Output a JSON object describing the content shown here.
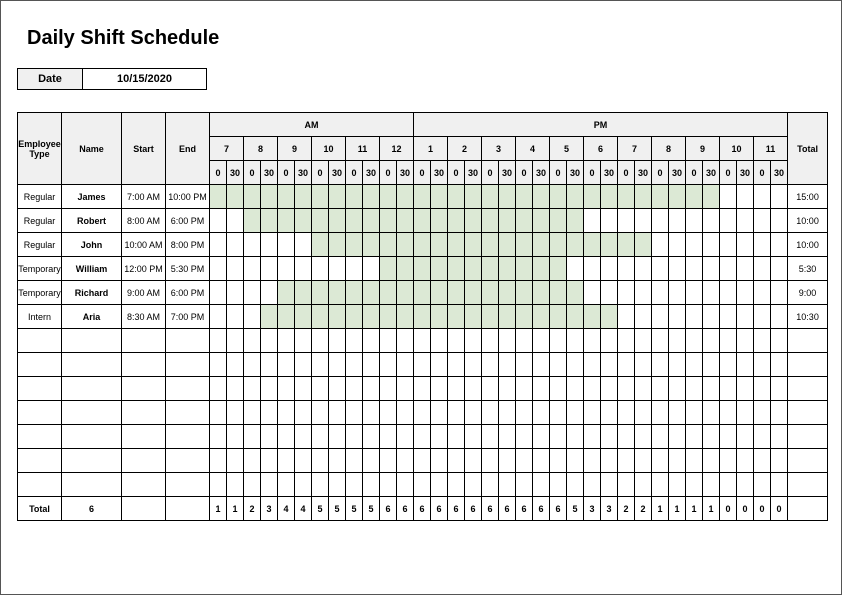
{
  "title": "Daily Shift Schedule",
  "date_label": "Date",
  "date_value": "10/15/2020",
  "headers": {
    "employee_type": "Employee Type",
    "name": "Name",
    "start": "Start",
    "end": "End",
    "am": "AM",
    "pm": "PM",
    "total": "Total"
  },
  "hours": [
    "7",
    "8",
    "9",
    "10",
    "11",
    "12",
    "1",
    "2",
    "3",
    "4",
    "5",
    "6",
    "7",
    "8",
    "9",
    "10",
    "11"
  ],
  "sub": [
    "0",
    "30"
  ],
  "employees": [
    {
      "type": "Regular",
      "name": "James",
      "start": "7:00 AM",
      "end": "10:00 PM",
      "from": 0,
      "to": 30,
      "total": "15:00"
    },
    {
      "type": "Regular",
      "name": "Robert",
      "start": "8:00 AM",
      "end": "6:00 PM",
      "from": 2,
      "to": 22,
      "total": "10:00"
    },
    {
      "type": "Regular",
      "name": "John",
      "start": "10:00 AM",
      "end": "8:00 PM",
      "from": 6,
      "to": 26,
      "total": "10:00"
    },
    {
      "type": "Temporary",
      "name": "William",
      "start": "12:00 PM",
      "end": "5:30 PM",
      "from": 10,
      "to": 21,
      "total": "5:30"
    },
    {
      "type": "Temporary",
      "name": "Richard",
      "start": "9:00 AM",
      "end": "6:00 PM",
      "from": 4,
      "to": 22,
      "total": "9:00"
    },
    {
      "type": "Intern",
      "name": "Aria",
      "start": "8:30 AM",
      "end": "7:00 PM",
      "from": 3,
      "to": 24,
      "total": "10:30"
    }
  ],
  "blank_rows": 7,
  "footer": {
    "label": "Total",
    "count": "6",
    "per_slot": [
      "1",
      "1",
      "2",
      "3",
      "4",
      "4",
      "5",
      "5",
      "5",
      "5",
      "6",
      "6",
      "6",
      "6",
      "6",
      "6",
      "6",
      "6",
      "6",
      "6",
      "6",
      "5",
      "3",
      "3",
      "2",
      "2",
      "1",
      "1",
      "1",
      "1",
      "0",
      "0",
      "0",
      "0"
    ],
    "grand_total": ""
  },
  "chart_data": {
    "type": "table",
    "title": "Daily Shift Schedule – 10/15/2020",
    "columns": [
      "Employee Type",
      "Name",
      "Start",
      "End",
      "Total Hours"
    ],
    "rows": [
      [
        "Regular",
        "James",
        "7:00 AM",
        "10:00 PM",
        "15:00"
      ],
      [
        "Regular",
        "Robert",
        "8:00 AM",
        "6:00 PM",
        "10:00"
      ],
      [
        "Regular",
        "John",
        "10:00 AM",
        "8:00 PM",
        "10:00"
      ],
      [
        "Temporary",
        "William",
        "12:00 PM",
        "5:30 PM",
        "5:30"
      ],
      [
        "Temporary",
        "Richard",
        "9:00 AM",
        "6:00 PM",
        "9:00"
      ],
      [
        "Intern",
        "Aria",
        "8:30 AM",
        "7:00 PM",
        "10:30"
      ]
    ],
    "time_slots_start": "7:00 AM",
    "time_slots_end": "11:30 PM",
    "slot_interval_minutes": 30,
    "headcount_per_slot": [
      1,
      1,
      2,
      3,
      4,
      4,
      5,
      5,
      5,
      5,
      6,
      6,
      6,
      6,
      6,
      6,
      6,
      6,
      6,
      6,
      6,
      5,
      3,
      3,
      2,
      2,
      1,
      1,
      1,
      1,
      0,
      0,
      0,
      0
    ],
    "total_employees": 6
  }
}
